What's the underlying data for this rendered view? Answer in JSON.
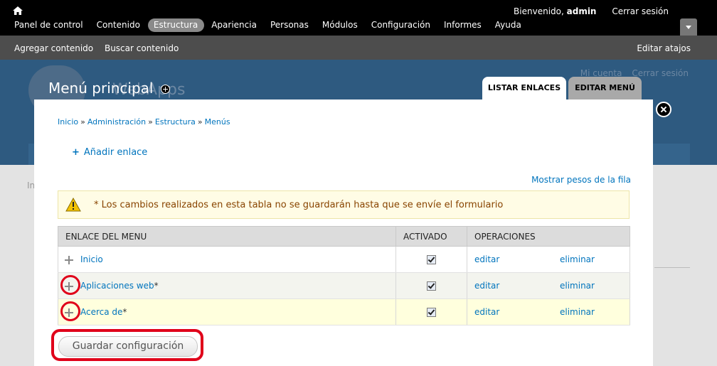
{
  "toolbar": {
    "welcome": "Bienvenido, ",
    "username": "admin",
    "logout": "Cerrar sesión",
    "menu": [
      {
        "label": "Panel de control",
        "active": false
      },
      {
        "label": "Contenido",
        "active": false
      },
      {
        "label": "Estructura",
        "active": true
      },
      {
        "label": "Apariencia",
        "active": false
      },
      {
        "label": "Personas",
        "active": false
      },
      {
        "label": "Módulos",
        "active": false
      },
      {
        "label": "Configuración",
        "active": false
      },
      {
        "label": "Informes",
        "active": false
      },
      {
        "label": "Ayuda",
        "active": false
      }
    ]
  },
  "shortcuts": {
    "items": [
      "Agregar contenido",
      "Buscar contenido"
    ],
    "edit": "Editar atajos"
  },
  "site": {
    "name": "WebApps",
    "secondary": [
      "Mi cuenta",
      "Cerrar sesión"
    ]
  },
  "overlay": {
    "title": "Menú principal",
    "tabs": [
      "LISTAR ENLACES",
      "EDITAR MENÚ"
    ],
    "breadcrumb": [
      "Inicio",
      "Administración",
      "Estructura",
      "Menús"
    ],
    "breadcrumb_sep": "»",
    "add_link": "Añadir enlace",
    "show_weights": "Mostrar pesos de la fila",
    "warning": "* Los cambios realizados en esta tabla no se guardarán hasta que se envíe el formulario",
    "table": {
      "headers": [
        "ENLACE DEL MENU",
        "ACTIVADO",
        "OPERACIONES"
      ],
      "rows": [
        {
          "label": "Inicio",
          "changed": "",
          "enabled": true,
          "edit": "editar",
          "delete": "eliminar"
        },
        {
          "label": "Aplicaciones web",
          "changed": "*",
          "enabled": true,
          "edit": "editar",
          "delete": "eliminar"
        },
        {
          "label": "Acerca de",
          "changed": "*",
          "enabled": true,
          "edit": "editar",
          "delete": "eliminar"
        }
      ]
    },
    "save_button": "Guardar configuración"
  },
  "colors": {
    "link": "#0074bd",
    "highlight_ring": "#e0001a",
    "toolbar_bg": "#000000",
    "warning_bg": "#fffce5"
  }
}
